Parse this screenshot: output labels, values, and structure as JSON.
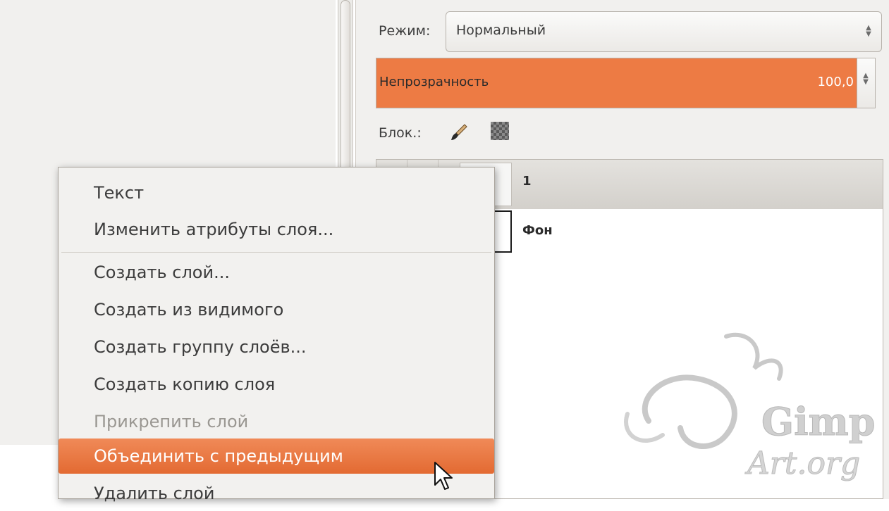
{
  "layers_panel": {
    "mode_label": "Режим:",
    "mode_value": "Нормальный",
    "opacity_label": "Непрозрачность",
    "opacity_value": "100,0",
    "lock_label": "Блок.:",
    "layers": [
      {
        "name": "1"
      },
      {
        "name": "Фон"
      }
    ]
  },
  "context_menu": {
    "items": [
      {
        "label": "Текст"
      },
      {
        "label": "Изменить атрибуты слоя..."
      },
      {
        "label": "Создать слой..."
      },
      {
        "label": "Создать из видимого"
      },
      {
        "label": "Создать группу слоёв..."
      },
      {
        "label": "Создать копию слоя"
      },
      {
        "label": "Прикрепить слой",
        "disabled": true
      },
      {
        "label": "Объединить с предыдущим",
        "highlighted": true
      },
      {
        "label": "Удалить слой"
      }
    ]
  },
  "watermark": {
    "line1": "Gimp",
    "line2": "Art.org"
  },
  "colors": {
    "accent": "#ED7B44",
    "highlight": "#E8703A"
  }
}
